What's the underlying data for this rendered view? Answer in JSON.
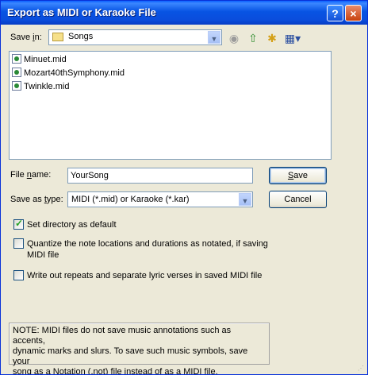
{
  "window": {
    "title": "Export as MIDI or Karaoke File",
    "help_label": "?",
    "close_label": "×"
  },
  "save_in": {
    "label_prefix": "Save ",
    "label_key": "i",
    "label_suffix": "n:",
    "value": "Songs"
  },
  "toolbar": {
    "back_icon": "back-icon",
    "up_icon": "up-folder-icon",
    "new_folder_icon": "new-folder-icon",
    "views_icon": "views-menu-icon"
  },
  "files": [
    {
      "name": "Minuet.mid"
    },
    {
      "name": "Mozart40thSymphony.mid"
    },
    {
      "name": "Twinkle.mid"
    }
  ],
  "file_name": {
    "label_prefix": "File ",
    "label_key": "n",
    "label_suffix": "ame:",
    "value": "YourSong"
  },
  "save_as_type": {
    "label_prefix": "Save as ",
    "label_key": "t",
    "label_suffix": "ype:",
    "value": "MIDI (*.mid) or Karaoke (*.kar)"
  },
  "buttons": {
    "save_key": "S",
    "save_rest": "ave",
    "cancel": "Cancel"
  },
  "options": [
    {
      "line1": "Set directory as default",
      "line2": "",
      "checked": true
    },
    {
      "line1": "Quantize the note locations and durations as notated, if saving",
      "line2": "MIDI file",
      "checked": false
    },
    {
      "line1": "Write out repeats and separate lyric verses in saved MIDI file",
      "line2": "",
      "checked": false
    }
  ],
  "note": {
    "line1": "NOTE: MIDI files do not save music annotations such as accents,",
    "line2": "dynamic marks and slurs.  To save such music symbols, save your",
    "line3": "song as a Notation (.not) file instead of as a MIDI file."
  },
  "colors": {
    "titlebar": "#0854e3",
    "dialog_bg": "#ece9d8",
    "border_blue": "#7f9db9"
  }
}
